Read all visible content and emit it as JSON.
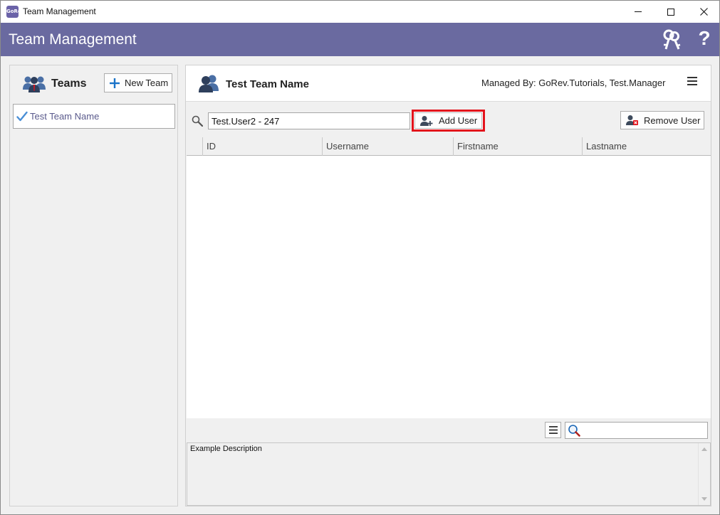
{
  "window": {
    "title": "Team Management",
    "app_icon_text": "GoRev"
  },
  "header": {
    "title": "Team Management",
    "help_glyph": "?"
  },
  "teams_panel": {
    "title": "Teams",
    "new_team_label": "New Team",
    "teams": [
      {
        "name": "Test Team Name",
        "selected": true
      }
    ]
  },
  "team_detail": {
    "name": "Test Team Name",
    "managed_by": "Managed By: GoRev.Tutorials, Test.Manager",
    "search_value": "Test.User2 - 247",
    "add_user_label": "Add User",
    "remove_user_label": "Remove User",
    "columns": [
      "ID",
      "Username",
      "Firstname",
      "Lastname"
    ],
    "rows": [],
    "filter_value": "",
    "description": "Example Description"
  },
  "colors": {
    "header_bg": "#6a6aa0",
    "highlight_border": "#e3121b",
    "team_item_text": "#5a5a8c",
    "check_accent": "#4a8fd6",
    "plus_accent": "#1a73c8"
  },
  "icons": {
    "app": "app-logo-icon",
    "keys": "keys-icon",
    "help": "help-icon",
    "teams": "users-group-icon",
    "new_team": "plus-icon",
    "selected": "check-icon",
    "team": "users-icon",
    "menu": "hamburger-menu-icon",
    "search": "search-icon",
    "add_user": "add-user-icon",
    "remove_user": "remove-user-icon",
    "list": "list-icon",
    "filter": "filter-search-icon"
  }
}
